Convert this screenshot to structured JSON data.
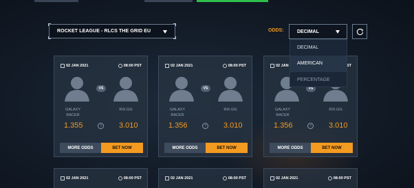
{
  "game_select": {
    "value": "ROCKET LEAGUE - RLCS THE GRID EU"
  },
  "odds": {
    "label": "ODDS:",
    "selected": "DECIMAL",
    "options": [
      "DECIMAL",
      "AMERICAN",
      "PERCENTAGE"
    ]
  },
  "matches": [
    {
      "date": "02 JAN 2021",
      "time": "08:00 PST",
      "team1": "GALAXY RACER",
      "team2": "RIX.GG",
      "odd1": "1.355",
      "odd2": "3.010",
      "vs": "VS",
      "help": "?",
      "more_label": "MORE ODDS",
      "bet_label": "BET NOW"
    },
    {
      "date": "02 JAN 2021",
      "time": "08:00 PST",
      "team1": "GALAXY RACER",
      "team2": "RIX.GG",
      "odd1": "1.356",
      "odd2": "3.010",
      "vs": "VS",
      "help": "?",
      "more_label": "MORE ODDS",
      "bet_label": "BET NOW"
    },
    {
      "date": "02 JAN 2021",
      "time": "08:00 PST",
      "team1": "GALAXY RACER",
      "team2": "RIX.GG",
      "odd1": "1.356",
      "odd2": "3.010",
      "vs": "VS",
      "help": "?",
      "more_label": "MORE ODDS",
      "bet_label": "BET NOW"
    }
  ],
  "next_matches": [
    {
      "date": "02 JAN 2021",
      "time": "08:00 PST"
    },
    {
      "date": "02 JAN 2021",
      "time": "08:00 PST"
    },
    {
      "date": "02 JAN 2021",
      "time": "08:00 PST"
    }
  ],
  "icons": {
    "calendar": "calendar-icon",
    "clock": "clock-icon",
    "refresh": "refresh-icon",
    "dropdown": "chevron-down-icon"
  },
  "colors": {
    "accent": "#f39a21",
    "highlight_green": "#2fbf4c"
  }
}
